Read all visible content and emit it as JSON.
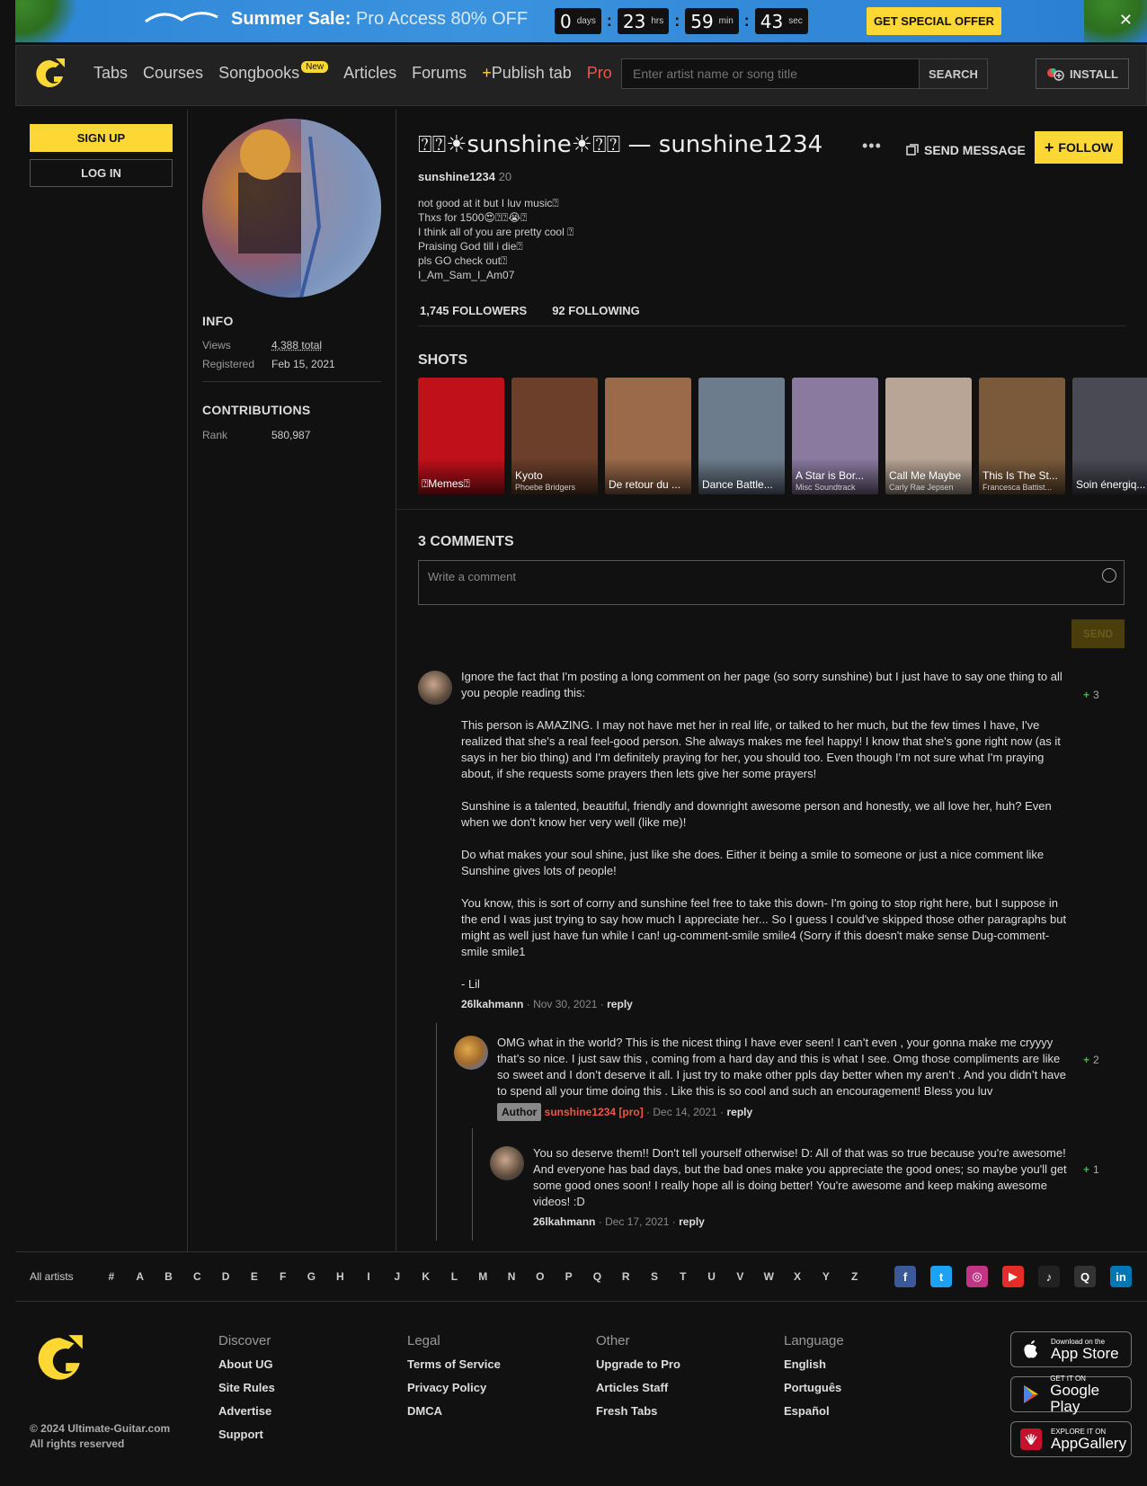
{
  "promo": {
    "bold": "Summer Sale:",
    "text": " Pro Access 80% OFF",
    "timer": [
      {
        "value": "0",
        "unit": "days"
      },
      {
        "value": "23",
        "unit": "hrs"
      },
      {
        "value": "59",
        "unit": "min"
      },
      {
        "value": "43",
        "unit": "sec"
      }
    ],
    "sep": ":",
    "button": "GET SPECIAL OFFER",
    "close": "✕"
  },
  "header": {
    "nav": [
      "Tabs",
      "Courses",
      "Songbooks",
      "Articles",
      "Forums"
    ],
    "new_badge": "New",
    "publish_plus": "+",
    "publish": "Publish tab",
    "pro": "Pro",
    "search_placeholder": "Enter artist name or song title",
    "search_button": "SEARCH",
    "install": "INSTALL"
  },
  "left": {
    "signup": "SIGN UP",
    "login": "LOG IN"
  },
  "profile": {
    "info_title": "INFO",
    "views_label": "Views",
    "views_value": "4,388 total",
    "registered_label": "Registered",
    "registered_value": "Feb 15, 2021",
    "contrib_title": "CONTRIBUTIONS",
    "rank_label": "Rank",
    "rank_value": "580,987"
  },
  "main": {
    "title": "⍰⍰☀sunshine☀⍰⍰ — sunshine1234",
    "username": "sunshine1234",
    "level": " 20",
    "more": "•••",
    "send_message": "SEND MESSAGE",
    "follow": "FOLLOW",
    "bio": [
      "not good at it but I luv music⍰",
      "Thxs for 1500😍⍰⍰😭⍰",
      "I think all of you are pretty cool ⍰",
      "Praising God till i die⍰",
      "pls GO check out⍰",
      "I_Am_Sam_I_Am07"
    ],
    "followers": "1,745 FOLLOWERS",
    "following": "92 FOLLOWING",
    "shots_title": "SHOTS",
    "shots": [
      {
        "title": "⍰Memes⍰",
        "artist": "",
        "color": "#c0101a"
      },
      {
        "title": "Kyoto",
        "artist": "Phoebe Bridgers",
        "color": "#6b3f2a"
      },
      {
        "title": "De retour du ...",
        "artist": "",
        "color": "#9b6a4a"
      },
      {
        "title": "Dance Battle...",
        "artist": "",
        "color": "#6c7c8c"
      },
      {
        "title": "A Star is Bor...",
        "artist": "Misc Soundtrack",
        "color": "#8a7aa0"
      },
      {
        "title": "Call Me Maybe",
        "artist": "Carly Rae Jepsen",
        "color": "#b8a595"
      },
      {
        "title": "This Is The St...",
        "artist": "Francesca Battist...",
        "color": "#7a5a3a"
      },
      {
        "title": "Soin énergiq...",
        "artist": "",
        "color": "#4a4a55"
      }
    ],
    "comments_title": "3 COMMENTS",
    "comment_placeholder": "Write a comment",
    "send": "SEND"
  },
  "comments": [
    {
      "paras": [
        "Ignore the fact that I'm posting a long comment on her page (so sorry sunshine) but I just have to say one thing to all you people reading this:",
        "This person is AMAZING. I may not have met her in real life, or talked to her much, but the few times I have, I've realized that she's a real feel-good person. She always makes me feel happy! I know that she's gone right now (as it says in her bio thing) and I'm definitely praying for her, you should too. Even though I'm not sure what I'm praying about, if she requests some prayers then lets give her some prayers!",
        "Sunshine is a talented, beautiful, friendly and downright awesome person and honestly, we all love her, huh? Even when we don't know her very well (like me)!",
        "Do what makes your soul shine, just like she does. Either it being a smile to someone or just a nice comment like Sunshine gives lots of people!",
        "You know, this is sort of corny and sunshine feel free to take this down- I'm going to stop right here, but I suppose in the end I was just trying to say how much I appreciate her... So I guess I could've skipped those other paragraphs but might as well just have fun while I can! ug-comment-smile smile4 (Sorry if this doesn't make sense Dug-comment-smile smile1",
        "- Lil"
      ],
      "author": "26lkahmann",
      "date": "Nov 30, 2021",
      "reply": "reply",
      "votes": "3"
    },
    {
      "paras": [
        "OMG what in the world? This is the nicest thing I have ever seen! I can’t even , your gonna make me cryyyy that’s so nice. I just saw this , coming from a hard day and this is what I see. Omg those compliments are like so sweet and I don’t deserve it all. I just try to make other ppls day better when my aren’t . And you didn’t have to spend all your time doing this .  Like this is so cool and such an encouragement! Bless you luv"
      ],
      "badge": "Author",
      "author": "sunshine1234 [pro]",
      "date": "Dec 14, 2021",
      "reply": "reply",
      "votes": "2"
    },
    {
      "paras": [
        "You so deserve them!! Don't tell yourself otherwise! D: All of that was so true because you're awesome! And everyone has bad days, but the bad ones make you appreciate the good ones; so maybe you'll get some good ones soon! I really hope all is doing better! You're awesome and keep making awesome videos! :D"
      ],
      "author": "26lkahmann",
      "date": "Dec 17, 2021",
      "reply": "reply",
      "votes": "1"
    }
  ],
  "dot": "·",
  "plus": "+",
  "footer": {
    "all_artists": "All artists",
    "letters": [
      "#",
      "A",
      "B",
      "C",
      "D",
      "E",
      "F",
      "G",
      "H",
      "I",
      "J",
      "K",
      "L",
      "M",
      "N",
      "O",
      "P",
      "Q",
      "R",
      "S",
      "T",
      "U",
      "V",
      "W",
      "X",
      "Y",
      "Z"
    ],
    "copyright": "© 2024 Ultimate-Guitar.com",
    "rights": "All rights reserved",
    "cols": [
      {
        "title": "Discover",
        "links": [
          "About UG",
          "Site Rules",
          "Advertise",
          "Support"
        ]
      },
      {
        "title": "Legal",
        "links": [
          "Terms of Service",
          "Privacy Policy",
          "DMCA"
        ]
      },
      {
        "title": "Other",
        "links": [
          "Upgrade to Pro",
          "Articles Staff",
          "Fresh Tabs"
        ]
      },
      {
        "title": "Language",
        "links": [
          "English",
          "Português",
          "Español"
        ]
      }
    ],
    "stores": [
      {
        "small": "Download on the",
        "large": "App Store"
      },
      {
        "small": "GET IT ON",
        "large": "Google Play"
      },
      {
        "small": "EXPLORE IT ON",
        "large": "AppGallery"
      }
    ],
    "social": [
      {
        "icon": "facebook-icon",
        "glyph": "f",
        "color": "#3b5998"
      },
      {
        "icon": "twitter-icon",
        "glyph": "t",
        "color": "#1da1f2"
      },
      {
        "icon": "instagram-icon",
        "glyph": "◎",
        "color": "#c13584"
      },
      {
        "icon": "youtube-icon",
        "glyph": "▶",
        "color": "#e52d27"
      },
      {
        "icon": "tiktok-icon",
        "glyph": "♪",
        "color": "#222222"
      },
      {
        "icon": "quora-icon",
        "glyph": "Q",
        "color": "#333333"
      },
      {
        "icon": "linkedin-icon",
        "glyph": "in",
        "color": "#0077b5"
      }
    ]
  },
  "colors": {
    "accent": "#fdd835",
    "pro": "#f05545",
    "bg": "#111111"
  }
}
